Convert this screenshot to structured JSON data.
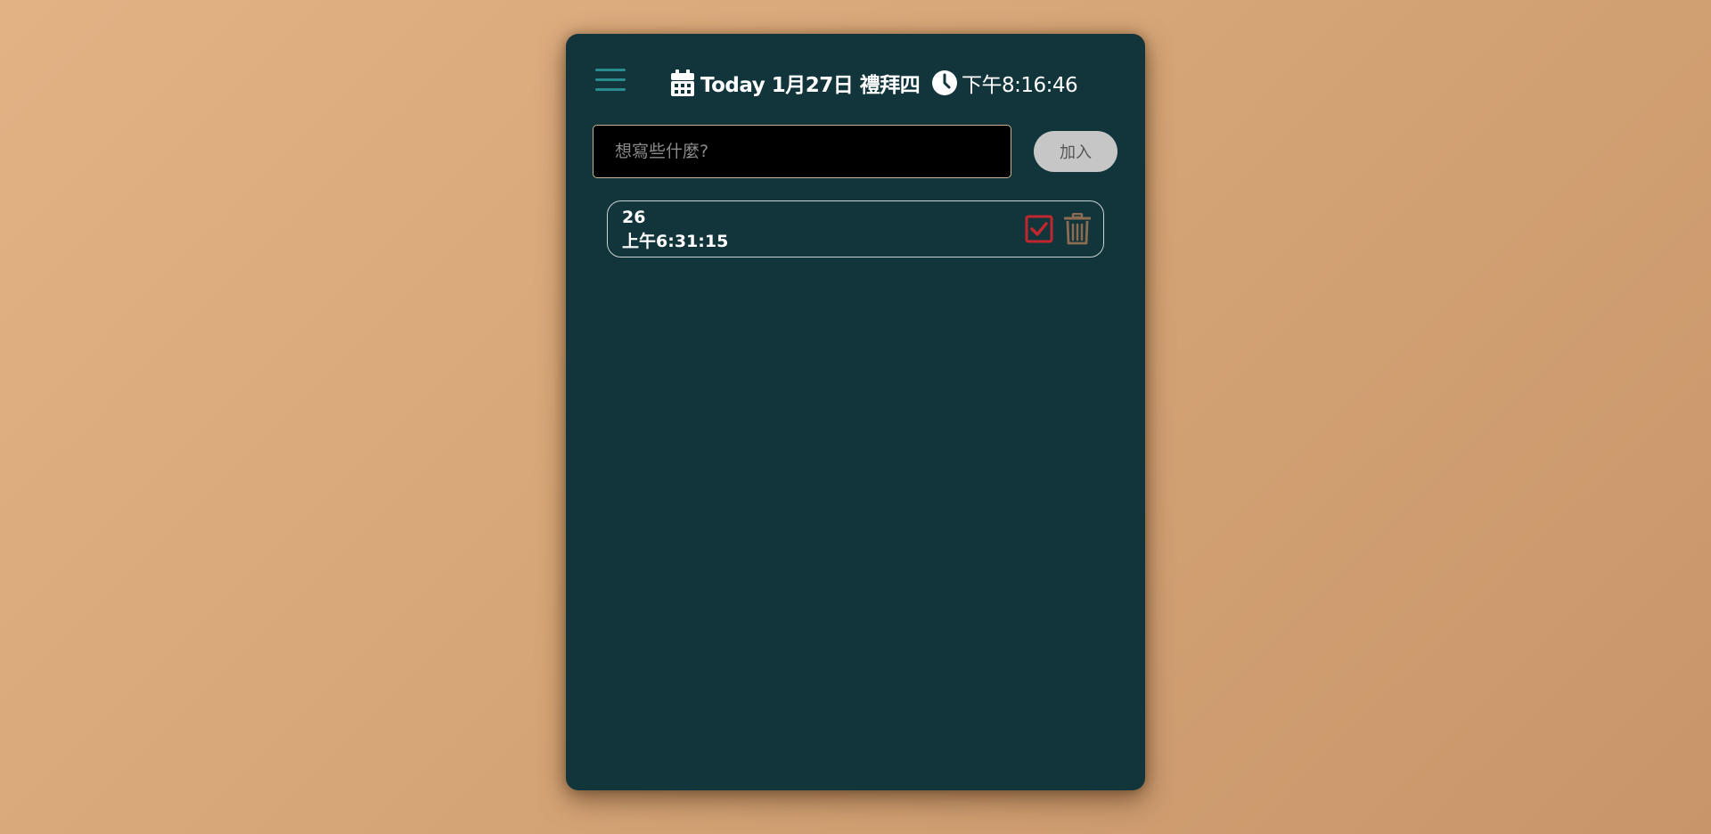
{
  "header": {
    "menu_icon": "hamburger-menu-icon",
    "calendar_icon": "calendar-icon",
    "date_text": "Today 1月27日 禮拜四",
    "clock_icon": "clock-icon",
    "time_text": "下午8:16:46"
  },
  "input": {
    "placeholder": "想寫些什麼?",
    "value": ""
  },
  "add_button": {
    "label": "加入"
  },
  "todos": [
    {
      "line1": "26",
      "line2": "上午6:31:15",
      "check_icon": "check-square-icon",
      "trash_icon": "trash-icon"
    }
  ],
  "colors": {
    "background": "#d6a677",
    "card": "#12343b",
    "menu": "#2a8b8f",
    "check": "#c0262d",
    "trash": "#8b6b52",
    "add_button": "#c6c6c6",
    "input_border": "#c9b48f"
  }
}
